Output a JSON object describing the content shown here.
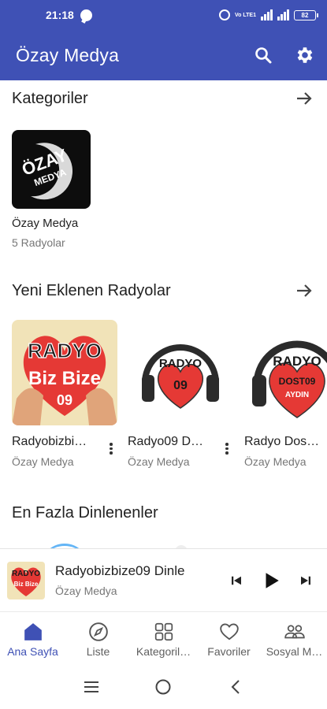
{
  "status_bar": {
    "time": "21:18",
    "network": "Vo LTE1",
    "battery": "82"
  },
  "app_bar": {
    "title": "Özay Medya",
    "search_icon": "search-icon",
    "settings_icon": "gear-icon"
  },
  "categories": {
    "title": "Kategoriler",
    "items": [
      {
        "title": "Özay Medya",
        "subtitle": "5 Radyolar",
        "logo_text": "ÖZAY MEDYA"
      }
    ]
  },
  "new_radios": {
    "title": "Yeni Eklenen Radyolar",
    "items": [
      {
        "title": "Radyobizbi…",
        "subtitle": "Özay Medya",
        "logo_top": "RADYO",
        "logo_mid": "Biz Bize",
        "logo_bottom": "09"
      },
      {
        "title": "Radyo09 D…",
        "subtitle": "Özay Medya",
        "logo_top": "RADYO",
        "logo_mid": "09"
      },
      {
        "title": "Radyo Dos…",
        "subtitle": "Özay Medya",
        "logo_top": "RADYO",
        "logo_mid": "DOST09",
        "logo_bottom": "AYDIN"
      }
    ]
  },
  "most_listened": {
    "title": "En Fazla Dinlenenler"
  },
  "player": {
    "title": "Radyobizbize09 Dinle",
    "subtitle": "Özay Medya",
    "logo_top": "RADYO",
    "logo_mid": "Biz Bize"
  },
  "bottom_nav": {
    "items": [
      {
        "label": "Ana Sayfa",
        "icon": "home-icon",
        "active": true
      },
      {
        "label": "Liste",
        "icon": "compass-icon",
        "active": false
      },
      {
        "label": "Kategoril…",
        "icon": "grid-icon",
        "active": false
      },
      {
        "label": "Favoriler",
        "icon": "heart-icon",
        "active": false
      },
      {
        "label": "Sosyal M…",
        "icon": "people-icon",
        "active": false
      }
    ]
  },
  "colors": {
    "primary": "#3f51b5",
    "heart_red": "#e53935"
  }
}
